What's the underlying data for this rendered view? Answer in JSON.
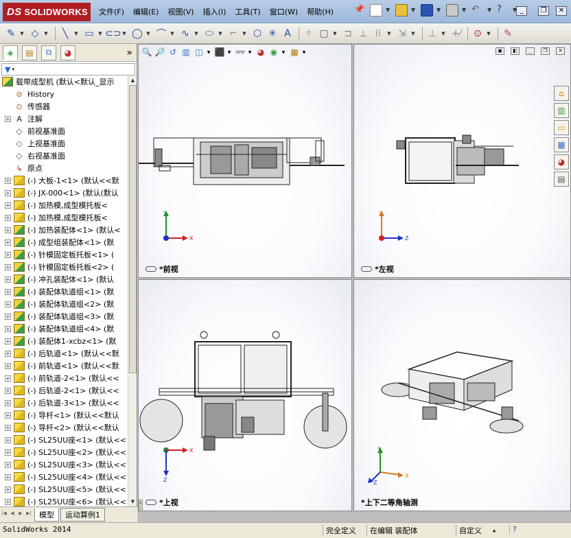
{
  "app": {
    "name": "SOLIDWORKS",
    "logo_prefix": "DS"
  },
  "menu": [
    "文件(F)",
    "编辑(E)",
    "视图(V)",
    "插入(I)",
    "工具(T)",
    "窗口(W)",
    "帮助(H)"
  ],
  "feature_manager": {
    "tabs": [
      "feature-manager-tab",
      "property-manager-tab",
      "configuration-manager-tab",
      "display-manager-tab"
    ],
    "collapse_symbol": "»",
    "root": "载带成型机  (默认<默认_显示",
    "items": [
      {
        "expand": "",
        "icon": "history",
        "label": "History"
      },
      {
        "expand": "",
        "icon": "sensor",
        "label": "传感器"
      },
      {
        "expand": "+",
        "icon": "annotation",
        "label": "注解"
      },
      {
        "expand": "",
        "icon": "plane",
        "label": "前视基准面"
      },
      {
        "expand": "",
        "icon": "plane",
        "label": "上视基准面"
      },
      {
        "expand": "",
        "icon": "plane",
        "label": "右视基准面"
      },
      {
        "expand": "",
        "icon": "origin",
        "label": "原点"
      },
      {
        "expand": "+",
        "icon": "part",
        "label": "(-) 大板-1<1> (默认<<默"
      },
      {
        "expand": "+",
        "icon": "part",
        "label": "(-) JX-000<1> (默认(默认"
      },
      {
        "expand": "+",
        "icon": "part",
        "label": "(-) 加热模,成型模托板<"
      },
      {
        "expand": "+",
        "icon": "part",
        "label": "(-) 加热模,成型模托板<"
      },
      {
        "expand": "+",
        "icon": "assembly",
        "label": "(-) 加热装配体<1> (默认<"
      },
      {
        "expand": "+",
        "icon": "assembly",
        "label": "(-) 成型组装配体<1> (默"
      },
      {
        "expand": "+",
        "icon": "assembly",
        "label": "(-) 针模固定板托板<1> ("
      },
      {
        "expand": "+",
        "icon": "assembly",
        "label": "(-) 针模固定板托板<2> ("
      },
      {
        "expand": "+",
        "icon": "assembly",
        "label": "(-) 冲孔装配体<1> (默认"
      },
      {
        "expand": "+",
        "icon": "assembly",
        "label": "(-) 装配体轨道组<1> (默"
      },
      {
        "expand": "+",
        "icon": "assembly",
        "label": "(-) 装配体轨道组<2> (默"
      },
      {
        "expand": "+",
        "icon": "assembly",
        "label": "(-) 装配体轨道组<3> (默"
      },
      {
        "expand": "+",
        "icon": "assembly",
        "label": "(-) 装配体轨道组<4> (默"
      },
      {
        "expand": "+",
        "icon": "assembly",
        "label": "(-) 装配体1-xcbz<1> (默"
      },
      {
        "expand": "+",
        "icon": "part",
        "label": "(-) 后轨道<1> (默认<<默"
      },
      {
        "expand": "+",
        "icon": "part",
        "label": "(-) 前轨道<1> (默认<<默"
      },
      {
        "expand": "+",
        "icon": "part",
        "label": "(-) 前轨道-2<1> (默认<<"
      },
      {
        "expand": "+",
        "icon": "part",
        "label": "(-) 后轨道-2<1> (默认<<"
      },
      {
        "expand": "+",
        "icon": "part",
        "label": "(-) 后轨道-3<1> (默认<<"
      },
      {
        "expand": "+",
        "icon": "part",
        "label": "(-) 导杆<1> (默认<<默认"
      },
      {
        "expand": "+",
        "icon": "part",
        "label": "(-) 导杆<2> (默认<<默认"
      },
      {
        "expand": "+",
        "icon": "part",
        "label": "(-) SL25UU座<1> (默认<<"
      },
      {
        "expand": "+",
        "icon": "part",
        "label": "(-) SL25UU座<2> (默认<<"
      },
      {
        "expand": "+",
        "icon": "part",
        "label": "(-) SL25UU座<3> (默认<<"
      },
      {
        "expand": "+",
        "icon": "part",
        "label": "(-) SL25UU座<4> (默认<<"
      },
      {
        "expand": "+",
        "icon": "part",
        "label": "(-) SL25UU座<5> (默认<<"
      },
      {
        "expand": "+",
        "icon": "part",
        "label": "(-) SL25UU座<6> (默认<<"
      }
    ],
    "bottom_tabs": [
      "模型",
      "运动算例1"
    ]
  },
  "viewports": [
    {
      "label": "*前视",
      "axes": [
        "Y",
        "X"
      ]
    },
    {
      "label": "*左视",
      "axes": [
        "Y",
        "Z"
      ]
    },
    {
      "label": "*上视",
      "axes": [
        "X",
        "Z"
      ]
    },
    {
      "label": "*上下二等角轴测",
      "axes": [
        "Y",
        "X",
        "Z"
      ]
    }
  ],
  "status_bar": {
    "app_version": "SolidWorks 2014",
    "constraint": "完全定义",
    "mode": "在编辑 装配体",
    "custom": "自定义",
    "help": "?"
  },
  "colors": {
    "logo_red": "#b01e24",
    "axis_x": "#d22020",
    "axis_y": "#2a8a2a",
    "axis_z": "#2030c8",
    "axis_orange": "#d57a20"
  }
}
